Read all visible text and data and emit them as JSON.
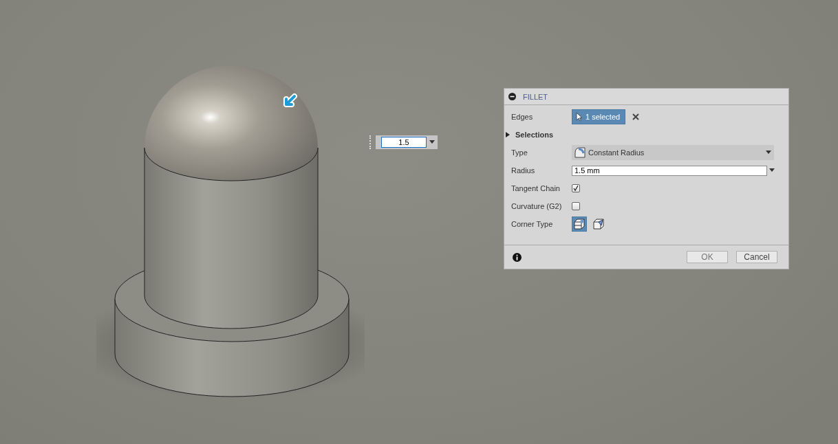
{
  "manipulator": {
    "value": "1.5"
  },
  "dialog": {
    "title": "FILLET",
    "edges": {
      "label": "Edges",
      "value": "1 selected"
    },
    "selections": {
      "label": "Selections",
      "expanded": false
    },
    "type": {
      "label": "Type",
      "value": "Constant Radius"
    },
    "radius": {
      "label": "Radius",
      "value": "1.5 mm"
    },
    "options": [
      {
        "label": "Tangent Chain",
        "checked": true
      },
      {
        "label": "Curvature (G2)",
        "checked": false
      }
    ],
    "corner_type": {
      "label": "Corner Type",
      "choices": [
        {
          "kind": "rolling",
          "selected": true
        },
        {
          "kind": "setback",
          "selected": false
        }
      ]
    },
    "buttons": [
      {
        "label": "OK",
        "kind": "ok"
      },
      {
        "label": "Cancel",
        "kind": "cancel"
      }
    ]
  }
}
